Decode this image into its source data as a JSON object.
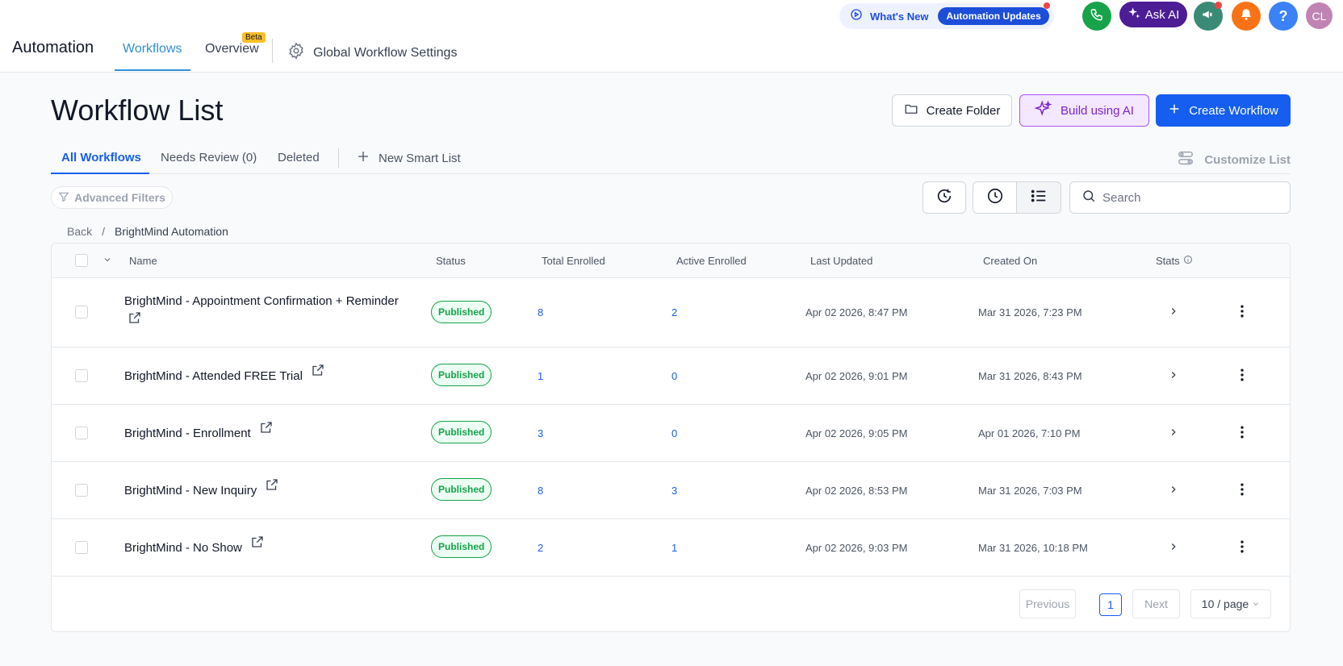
{
  "header": {
    "app_title": "Automation",
    "tabs": [
      {
        "label": "Workflows"
      },
      {
        "label": "Overview",
        "badge": "Beta"
      }
    ],
    "settings_label": "Global Workflow Settings",
    "whats_new_label": "What's New",
    "updates_label": "Automation Updates",
    "ask_ai_label": "Ask AI",
    "help_label": "?",
    "avatar_initials": "CL"
  },
  "page": {
    "title": "Workflow List",
    "create_folder_label": "Create Folder",
    "build_ai_label": "Build using AI",
    "create_workflow_label": "Create Workflow"
  },
  "subtabs": {
    "all": "All Workflows",
    "needs_review": "Needs Review (0)",
    "deleted": "Deleted",
    "new_smart_list": "New Smart List",
    "customize": "Customize List"
  },
  "filters": {
    "advanced_label": "Advanced Filters",
    "search_placeholder": "Search"
  },
  "breadcrumb": {
    "back": "Back",
    "separator": "/",
    "current": "BrightMind Automation"
  },
  "table": {
    "columns": {
      "name": "Name",
      "status": "Status",
      "total": "Total Enrolled",
      "active": "Active Enrolled",
      "updated": "Last Updated",
      "created": "Created On",
      "stats": "Stats"
    },
    "rows": [
      {
        "name_line1": "BrightMind - Appointment Confirmation + Reminder",
        "status": "Published",
        "total": "8",
        "active": "2",
        "updated": "Apr 02 2026, 8:47 PM",
        "created": "Mar 31 2026, 7:23 PM"
      },
      {
        "name": "BrightMind - Attended FREE Trial",
        "status": "Published",
        "total": "1",
        "active": "0",
        "updated": "Apr 02 2026, 9:01 PM",
        "created": "Mar 31 2026, 8:43 PM"
      },
      {
        "name": "BrightMind - Enrollment",
        "status": "Published",
        "total": "3",
        "active": "0",
        "updated": "Apr 02 2026, 9:05 PM",
        "created": "Apr 01 2026, 7:10 PM"
      },
      {
        "name": "BrightMind - New Inquiry",
        "status": "Published",
        "total": "8",
        "active": "3",
        "updated": "Apr 02 2026, 8:53 PM",
        "created": "Mar 31 2026, 7:03 PM"
      },
      {
        "name": "BrightMind - No Show",
        "status": "Published",
        "total": "2",
        "active": "1",
        "updated": "Apr 02 2026, 9:03 PM",
        "created": "Mar 31 2026, 10:18 PM"
      }
    ]
  },
  "pagination": {
    "previous": "Previous",
    "current_page": "1",
    "next": "Next",
    "page_size": "10 / page"
  },
  "colors": {
    "primary": "#155eef",
    "nav_active": "#2f8fd8",
    "published_green": "#16a34a",
    "ai_purple": "#7e22ce"
  }
}
